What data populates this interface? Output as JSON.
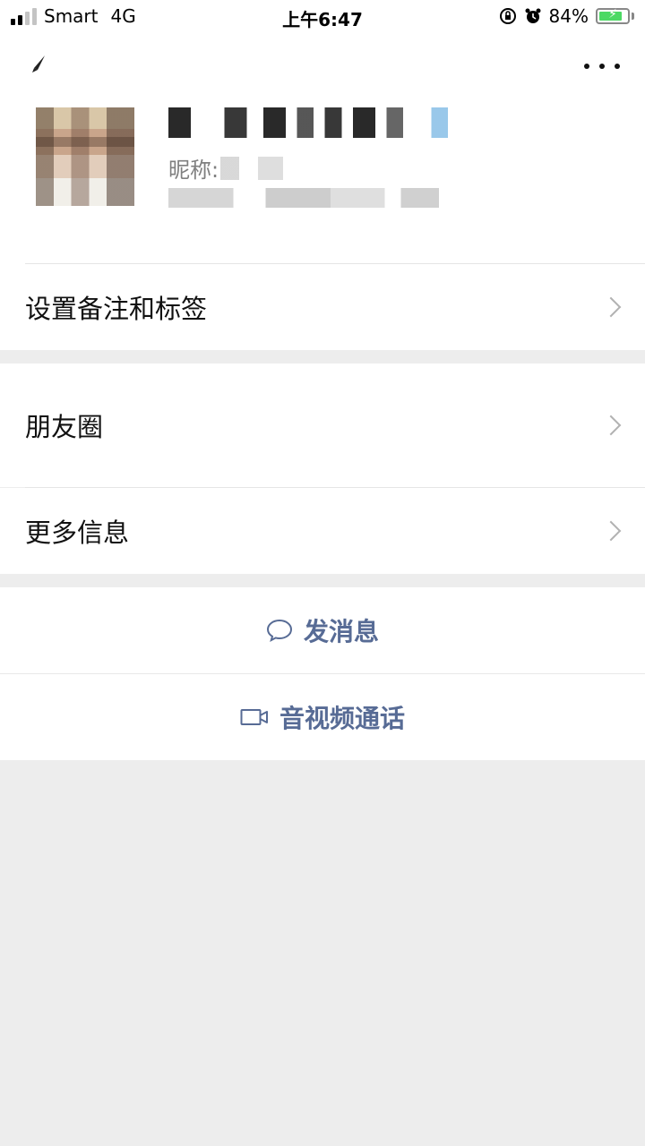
{
  "status_bar": {
    "carrier": "Smart",
    "network": "4G",
    "time": "上午6:47",
    "battery_percent": "84%",
    "battery_level": 0.84,
    "accent_battery": "#4cd964"
  },
  "profile": {
    "nickname_label": "昵称:"
  },
  "menu": {
    "remark_tags": "设置备注和标签",
    "moments": "朋友圈",
    "more_info": "更多信息"
  },
  "actions": {
    "send_message": "发消息",
    "av_call": "音视频通话",
    "link_color": "#576b95"
  },
  "icons": [
    "back-icon",
    "more-icon",
    "chat-bubble-icon",
    "video-camera-icon",
    "chevron-right-icon",
    "alarm-icon",
    "orientation-lock-icon"
  ]
}
